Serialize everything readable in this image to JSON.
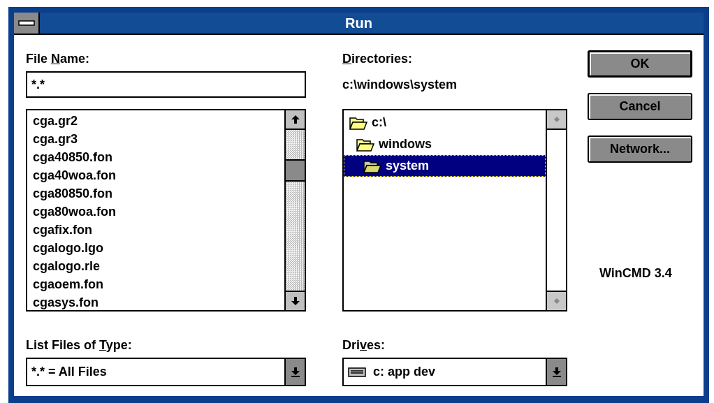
{
  "window": {
    "title": "Run"
  },
  "file_name": {
    "label_before": "File ",
    "access_key": "N",
    "label_after": "ame:",
    "value": "*.*"
  },
  "files": [
    "cga.gr2",
    "cga.gr3",
    "cga40850.fon",
    "cga40woa.fon",
    "cga80850.fon",
    "cga80woa.fon",
    "cgafix.fon",
    "cgalogo.lgo",
    "cgalogo.rle",
    "cgaoem.fon",
    "cgasys.fon"
  ],
  "directories": {
    "access_key": "D",
    "label_after": "irectories:",
    "current_path": "c:\\windows\\system",
    "tree": [
      {
        "label": "c:\\",
        "selected": false,
        "children": [
          {
            "label": "windows",
            "selected": false,
            "children": [
              {
                "label": "system",
                "selected": true
              }
            ]
          }
        ]
      }
    ]
  },
  "buttons": [
    {
      "label": "OK",
      "default": true
    },
    {
      "label": "Cancel",
      "default": false
    },
    {
      "label": "Network...",
      "default": false
    }
  ],
  "version": "WinCMD 3.4",
  "file_type": {
    "label_before": "List Files of ",
    "access_key": "T",
    "label_after": "ype:",
    "value": "*.* = All Files"
  },
  "drives": {
    "label_before": "Dri",
    "access_key": "v",
    "label_after": "es:",
    "value": "c: app dev"
  }
}
